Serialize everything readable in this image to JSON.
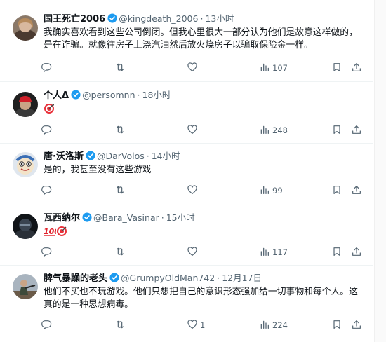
{
  "tweets": [
    {
      "name": "国王死亡2006",
      "handle": "@kingdeath_2006",
      "time": "13小时",
      "text": "我确实喜欢看到这些公司倒闭。但我心里很大一部分认为他们是故意这样做的，是在诈骗。就像往房子上浇汽油然后放火烧房子以骗取保险金一样。",
      "replies": "",
      "retweets": "",
      "likes": "",
      "views": "107",
      "avatar_icon": "woman-portrait-avatar"
    },
    {
      "name": "个人Δ",
      "handle": "@persomnn",
      "time": "18小时",
      "text": "",
      "emoji": "direct-hit-emoji",
      "replies": "",
      "retweets": "",
      "likes": "",
      "views": "248",
      "avatar_icon": "red-cap-man-avatar"
    },
    {
      "name": "唐·沃洛斯",
      "handle": "@DarVolos",
      "time": "14小时",
      "text": "是的，我甚至没有这些游戏",
      "replies": "",
      "retweets": "",
      "likes": "",
      "views": "99",
      "avatar_icon": "cartoon-mascot-avatar"
    },
    {
      "name": "瓦西纳尔",
      "handle": "@Bara_Vasinar",
      "time": "15小时",
      "text": "",
      "emoji": "hundred-points-and-direct-hit-emoji",
      "replies": "",
      "retweets": "",
      "likes": "",
      "views": "117",
      "avatar_icon": "dark-armored-avatar"
    },
    {
      "name": "脾气暴躁的老头",
      "handle": "@GrumpyOldMan742",
      "time": "12月17日",
      "text": "他们不买也不玩游戏。他们只想把自己的意识形态强加给一切事物和每个人。这真的是一种思想病毒。",
      "replies": "",
      "retweets": "",
      "likes": "1",
      "views": "224",
      "avatar_icon": "armed-figure-avatar"
    }
  ],
  "colors": {
    "verified": "#1d9bf0",
    "muted": "#536471",
    "text": "#0f1419",
    "border": "#eff3f4"
  },
  "icons": [
    "reply-icon",
    "retweet-icon",
    "like-icon",
    "views-icon",
    "bookmark-icon",
    "share-icon",
    "verified-badge-icon"
  ]
}
